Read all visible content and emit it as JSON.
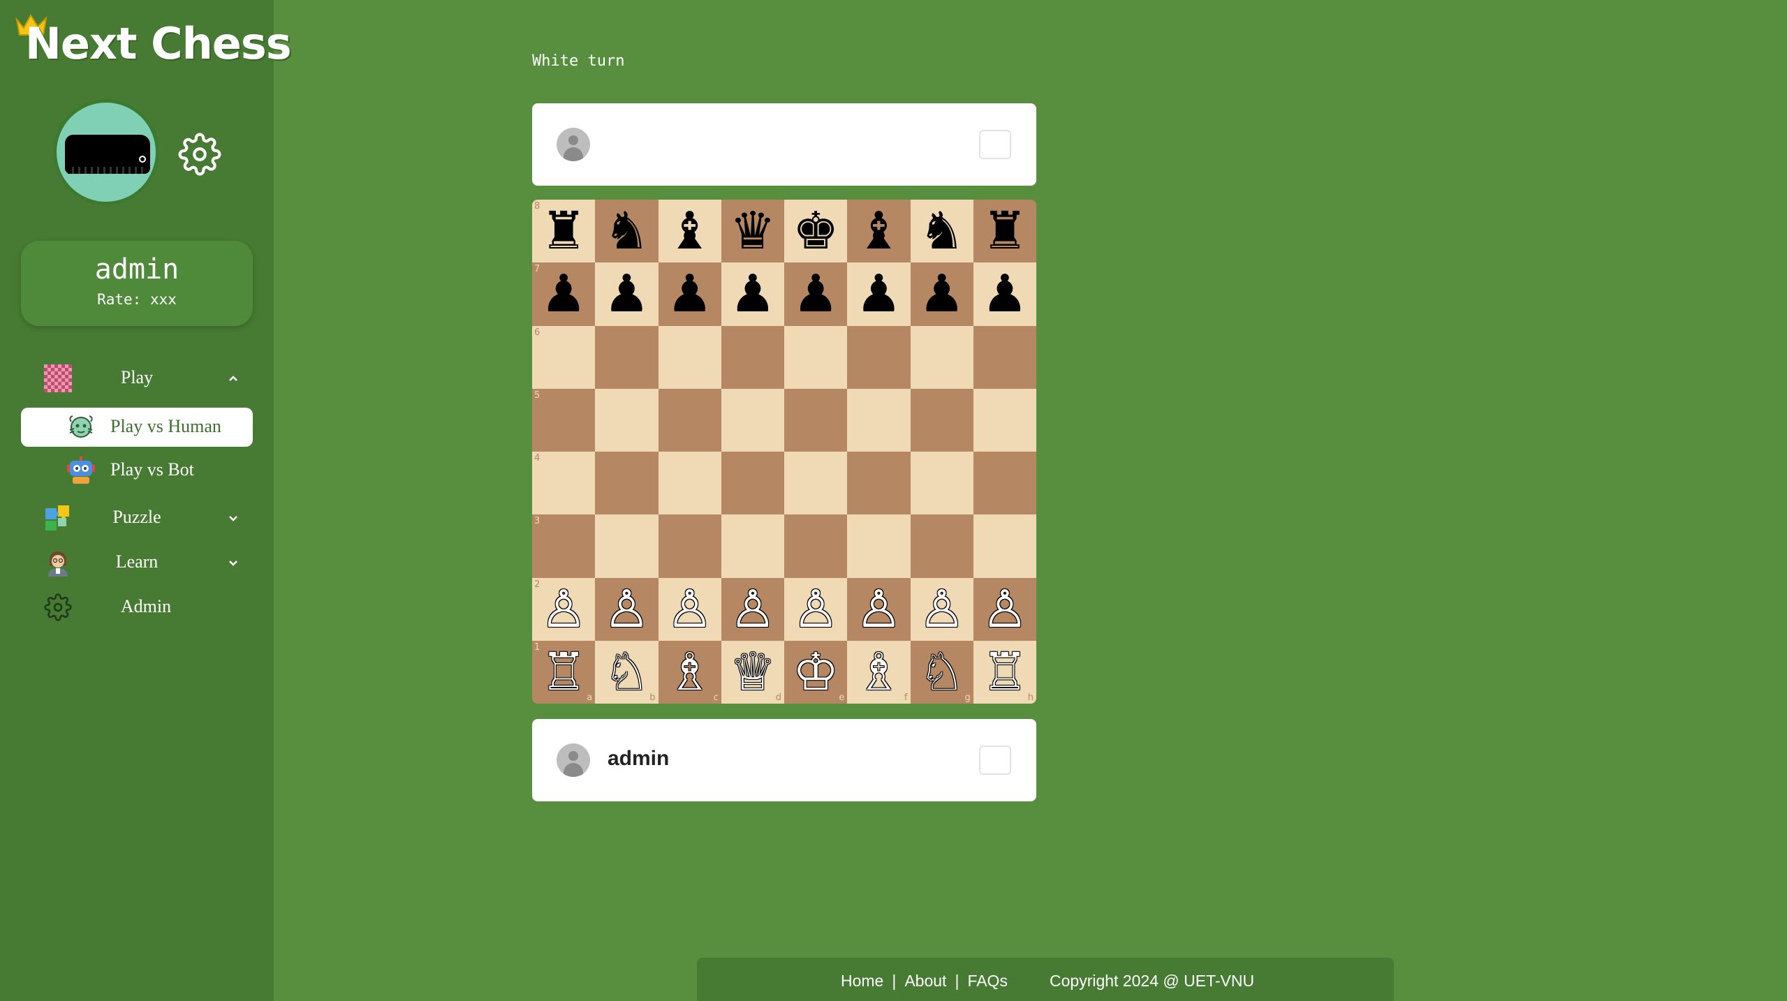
{
  "app": {
    "logo_text": "Next Chess"
  },
  "sidebar": {
    "user": {
      "name": "admin",
      "rate": "Rate: xxx"
    },
    "nav": {
      "play": {
        "label": "Play",
        "icon": "checkered-board-icon",
        "expanded": true
      },
      "play_vs_human": {
        "label": "Play vs Human",
        "icon": "alien-face-icon",
        "active": true
      },
      "play_vs_bot": {
        "label": "Play vs Bot",
        "icon": "robot-icon"
      },
      "puzzle": {
        "label": "Puzzle",
        "icon": "puzzle-pieces-icon",
        "expanded": false
      },
      "learn": {
        "label": "Learn",
        "icon": "teacher-icon",
        "expanded": false
      },
      "admin": {
        "label": "Admin",
        "icon": "gear-icon"
      }
    }
  },
  "game": {
    "turn_text": "White turn",
    "top_player": {
      "name": ""
    },
    "bottom_player": {
      "name": "admin"
    }
  },
  "board": {
    "ranks": [
      [
        "♜",
        "♞",
        "♝",
        "♛",
        "♚",
        "♝",
        "♞",
        "♜"
      ],
      [
        "♟",
        "♟",
        "♟",
        "♟",
        "♟",
        "♟",
        "♟",
        "♟"
      ],
      [
        "",
        "",
        "",
        "",
        "",
        "",
        "",
        ""
      ],
      [
        "",
        "",
        "",
        "",
        "",
        "",
        "",
        ""
      ],
      [
        "",
        "",
        "",
        "",
        "",
        "",
        "",
        ""
      ],
      [
        "",
        "",
        "",
        "",
        "",
        "",
        "",
        ""
      ],
      [
        "♙",
        "♙",
        "♙",
        "♙",
        "♙",
        "♙",
        "♙",
        "♙"
      ],
      [
        "♖",
        "♘",
        "♗",
        "♕",
        "♔",
        "♗",
        "♘",
        "♖"
      ]
    ],
    "rank_labels": [
      "8",
      "7",
      "6",
      "5",
      "4",
      "3",
      "2",
      "1"
    ],
    "file_labels": [
      "a",
      "b",
      "c",
      "d",
      "e",
      "f",
      "g",
      "h"
    ],
    "light_color": "#f0d9b5",
    "dark_color": "#b58863"
  },
  "footer": {
    "home": "Home",
    "about": "About",
    "faqs": "FAQs",
    "separator": "|",
    "copyright": "Copyright 2024 @ UET-VNU"
  },
  "colors": {
    "background": "#578f3f",
    "sidebar": "#477a33",
    "avatar": "#7fd0b4"
  }
}
